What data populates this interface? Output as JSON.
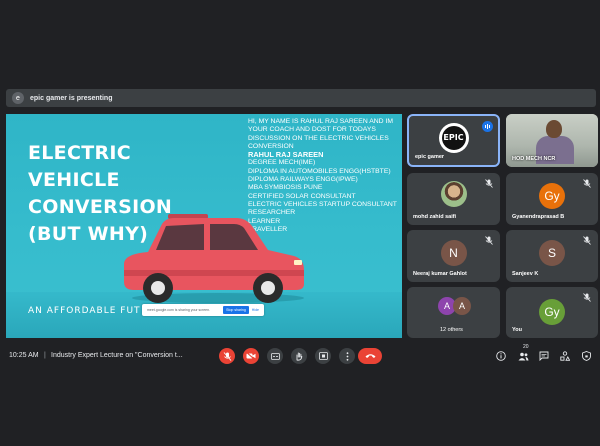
{
  "presenting": {
    "avatar_initial": "e",
    "text": "epic gamer is presenting"
  },
  "slide": {
    "title_lines": [
      "ELECTRIC",
      "VEHICLE",
      "CONVERSION",
      "(BUT WHY)"
    ],
    "bio_intro": "HI, MY NAME IS RAHUL RAJ SAREEN AND IM YOUR COACH AND DOST FOR TODAYS DISCUSSION ON THE ELECTRIC VEHICLES CONVERSION",
    "bio_name": "RAHUL RAJ SAREEN",
    "bio_items": [
      "DEGREE MECH(IME)",
      "DIPLOMA IN AUTOMOBILES ENGG(HSTBTE)",
      "DIPLOMA RAILWAYS ENGG(IPWE)",
      "MBA SYMBIOSIS PUNE",
      "CERTIFIED SOLAR CONSULTANT",
      "ELECTRIC VEHICLES STARTUP CONSULTANT",
      "RESEARCHER",
      "LEARNER",
      "TRAVELLER"
    ],
    "tagline": "AN AFFORDABLE FUT",
    "share_message": "meet.google.com is sharing your screen.",
    "stop_sharing": "Stop sharing",
    "hide": "Hide"
  },
  "participants": [
    {
      "name": "epic gamer",
      "type": "logo",
      "logo_text": "EPIC",
      "speaking": true
    },
    {
      "name": "HOD MECH NCR",
      "type": "camera"
    },
    {
      "name": "mohd zahid saifi",
      "type": "photo",
      "muted": true
    },
    {
      "name": "Gyanendraprasad B",
      "type": "initial",
      "initial": "Gy",
      "color": "#e8710a",
      "muted": true
    },
    {
      "name": "Neeraj kumar Gahlot",
      "type": "initial",
      "initial": "N",
      "color": "#795548",
      "muted": true
    },
    {
      "name": "Sanjeev K",
      "type": "initial",
      "initial": "S",
      "color": "#795548",
      "muted": true
    },
    {
      "name": "12 others",
      "type": "group",
      "initials": [
        "A",
        "A"
      ],
      "colors": [
        "#8e44ad",
        "#795548"
      ]
    },
    {
      "name": "You",
      "type": "initial",
      "initial": "Gy",
      "color": "#689f38",
      "muted": true
    }
  ],
  "bottom": {
    "time": "10:25 AM",
    "separator": "|",
    "meeting_title": "Industry Expert Lecture on \"Conversion t...",
    "participant_count": "20"
  },
  "colors": {
    "background": "#202124",
    "tile": "#3c4043",
    "accent": "#8ab4f8",
    "danger": "#ea4335",
    "slide_bg": "#36bccd",
    "car": "#e8555f"
  }
}
